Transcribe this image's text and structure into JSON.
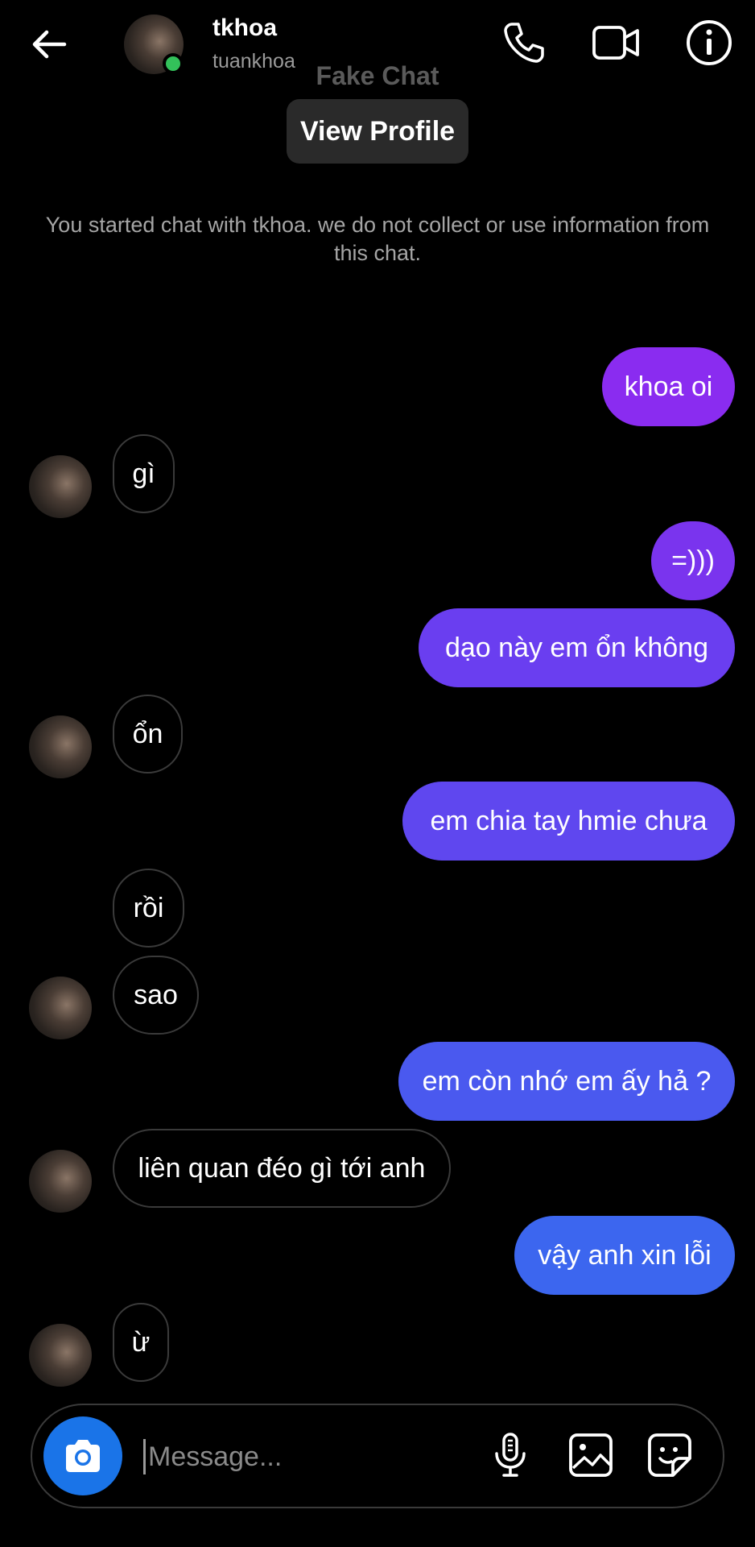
{
  "header": {
    "name": "tkhoa",
    "username": "tuankhoa",
    "watermark": "Fake Chat",
    "view_profile_label": "View Profile"
  },
  "notice": "You started chat with tkhoa. we do not collect or use information from this chat.",
  "messages": [
    {
      "dir": "out",
      "text": "khoa oi"
    },
    {
      "dir": "in",
      "text": "gì"
    },
    {
      "dir": "out",
      "text": "=)))"
    },
    {
      "dir": "out",
      "text": "dạo này em ổn không"
    },
    {
      "dir": "in",
      "text": "ổn"
    },
    {
      "dir": "out",
      "text": "em chia tay hmie chưa"
    },
    {
      "dir": "in",
      "text": "rồi"
    },
    {
      "dir": "in",
      "text": "sao"
    },
    {
      "dir": "out",
      "text": "em còn nhớ em ấy hả ?"
    },
    {
      "dir": "in",
      "text": "liên quan đéo gì tới anh"
    },
    {
      "dir": "out",
      "text": "vậy anh xin lỗi"
    },
    {
      "dir": "in",
      "text": "ừ"
    }
  ],
  "composer": {
    "placeholder": "Message..."
  },
  "icons": {
    "back": "arrow-left-icon",
    "call": "phone-icon",
    "video": "video-camera-icon",
    "info": "info-icon",
    "camera": "camera-icon",
    "mic": "microphone-icon",
    "gallery": "image-icon",
    "sticker": "sticker-icon"
  },
  "colors": {
    "bubble_gradient": [
      "#8a2cf0",
      "#7a34ee",
      "#6a3ef0",
      "#5f47ef",
      "#4a59ef",
      "#3c66ef",
      "#2d72ee"
    ],
    "camera_button": "#1a74e8",
    "online_dot": "#33c15a"
  }
}
